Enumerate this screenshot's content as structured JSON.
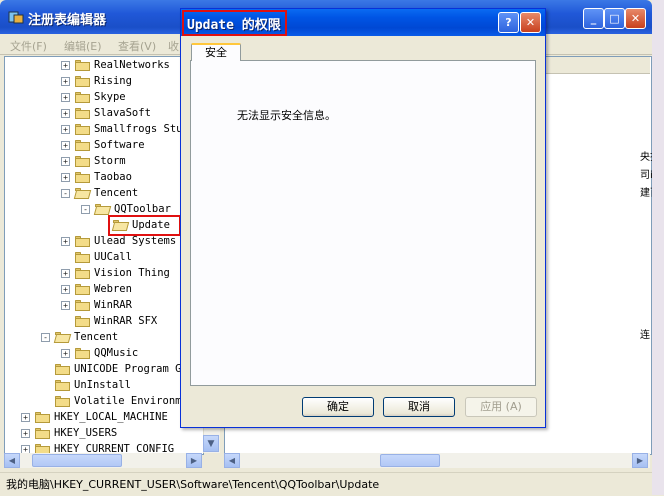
{
  "registry_window": {
    "title": "注册表编辑器",
    "menu": [
      "文件(F)",
      "编辑(E)",
      "查看(V)",
      "收"
    ],
    "status_path": "我的电脑\\HKEY_CURRENT_USER\\Software\\Tencent\\QQToolbar\\Update",
    "right_pane_peek": [
      "央打",
      "司i",
      "建百",
      "连"
    ]
  },
  "tree": {
    "rows": [
      {
        "label": "RealNetworks",
        "expander": "+",
        "open": false
      },
      {
        "label": "Rising",
        "expander": "+",
        "open": false
      },
      {
        "label": "Skype",
        "expander": "+",
        "open": false
      },
      {
        "label": "SlavaSoft",
        "expander": "+",
        "open": false
      },
      {
        "label": "Smallfrogs Stu",
        "expander": "+",
        "open": false
      },
      {
        "label": "Software",
        "expander": "+",
        "open": false
      },
      {
        "label": "Storm",
        "expander": "+",
        "open": false
      },
      {
        "label": "Taobao",
        "expander": "+",
        "open": false
      },
      {
        "label": "Tencent",
        "expander": "-",
        "open": true
      },
      {
        "label": "QQToolbar",
        "expander": "-",
        "open": true
      },
      {
        "label": "Update",
        "expander": "",
        "open": true,
        "selected": true
      },
      {
        "label": "Ulead Systems",
        "expander": "+",
        "open": false
      },
      {
        "label": "UUCall",
        "expander": "",
        "open": false
      },
      {
        "label": "Vision Thing",
        "expander": "+",
        "open": false
      },
      {
        "label": "Webren",
        "expander": "+",
        "open": false
      },
      {
        "label": "WinRAR",
        "expander": "+",
        "open": false
      },
      {
        "label": "WinRAR SFX",
        "expander": "",
        "open": false
      },
      {
        "label": "Tencent",
        "expander": "-",
        "open": true
      },
      {
        "label": "QQMusic",
        "expander": "+",
        "open": false
      },
      {
        "label": "UNICODE Program G",
        "expander": "",
        "open": false
      },
      {
        "label": "UnInstall",
        "expander": "",
        "open": false
      },
      {
        "label": "Volatile Environm",
        "expander": "",
        "open": false
      },
      {
        "label": "HKEY_LOCAL_MACHINE",
        "expander": "+",
        "open": false
      },
      {
        "label": "HKEY_USERS",
        "expander": "+",
        "open": false
      },
      {
        "label": "HKEY_CURRENT_CONFIG",
        "expander": "+",
        "open": false
      }
    ]
  },
  "dialog": {
    "title": "Update 的权限",
    "tab": "安全",
    "message": "无法显示安全信息。",
    "ok_label": "确定",
    "cancel_label": "取消",
    "apply_label": "应用 (A)"
  },
  "icons": {
    "help": "?",
    "close": "✕",
    "minimize": "_",
    "maximize": "□",
    "scroll_down": "▼",
    "scroll_left": "◀",
    "scroll_right": "▶"
  },
  "colors": {
    "title_bar": "#0055e5",
    "highlight_box": "#e01010",
    "tab_accent": "#ffc73c"
  }
}
